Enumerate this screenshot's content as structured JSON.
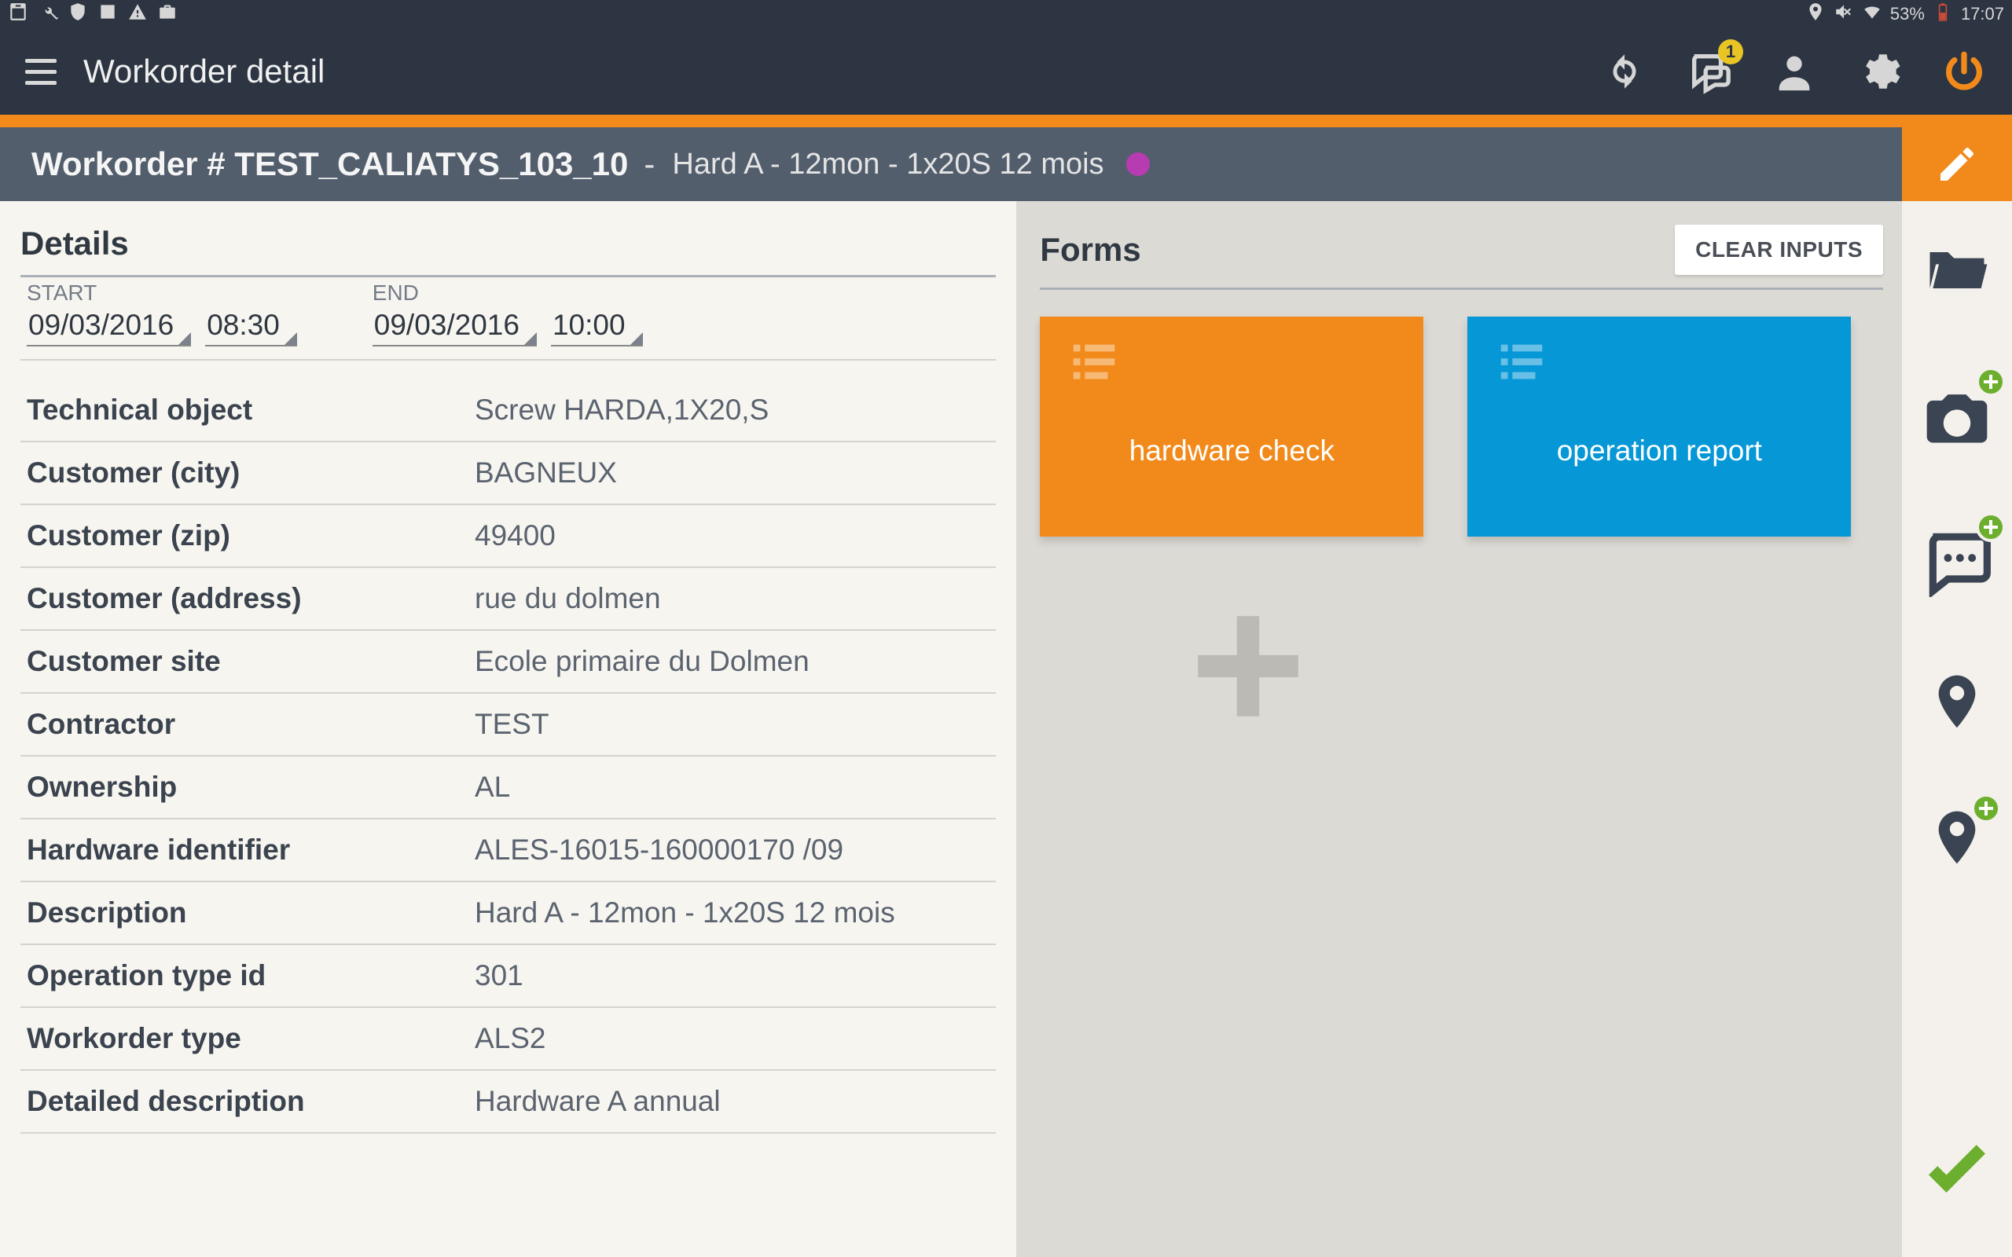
{
  "system_bar": {
    "battery_text": "53%",
    "clock": "17:07"
  },
  "appbar": {
    "title": "Workorder detail",
    "chat_badge": "1"
  },
  "banner": {
    "prefix": "Workorder # ",
    "wo_number": "TEST_CALIATYS_103_10",
    "separator": "-",
    "subtitle": "Hard A - 12mon - 1x20S 12 mois",
    "status_color": "#b73bb1"
  },
  "details": {
    "header": "Details",
    "start_label": "START",
    "start_date": "09/03/2016",
    "start_time": "08:30",
    "end_label": "END",
    "end_date": "09/03/2016",
    "end_time": "10:00",
    "rows": [
      {
        "label": "Technical object",
        "value": "Screw HARDA,1X20,S"
      },
      {
        "label": "Customer (city)",
        "value": "BAGNEUX"
      },
      {
        "label": "Customer (zip)",
        "value": "49400"
      },
      {
        "label": "Customer (address)",
        "value": "rue du dolmen"
      },
      {
        "label": "Customer site",
        "value": "Ecole primaire du Dolmen"
      },
      {
        "label": "Contractor",
        "value": "TEST"
      },
      {
        "label": "Ownership",
        "value": "AL"
      },
      {
        "label": "Hardware identifier",
        "value": "ALES-16015-160000170 /09"
      },
      {
        "label": "Description",
        "value": "Hard A - 12mon - 1x20S 12 mois"
      },
      {
        "label": "Operation type id",
        "value": "301"
      },
      {
        "label": "Workorder type",
        "value": "ALS2"
      },
      {
        "label": "Detailed description",
        "value": "Hardware A annual"
      }
    ]
  },
  "forms": {
    "header": "Forms",
    "clear_button": "CLEAR INPUTS",
    "cards": [
      {
        "title": "hardware check",
        "color": "orange"
      },
      {
        "title": "operation report",
        "color": "blue"
      }
    ]
  }
}
